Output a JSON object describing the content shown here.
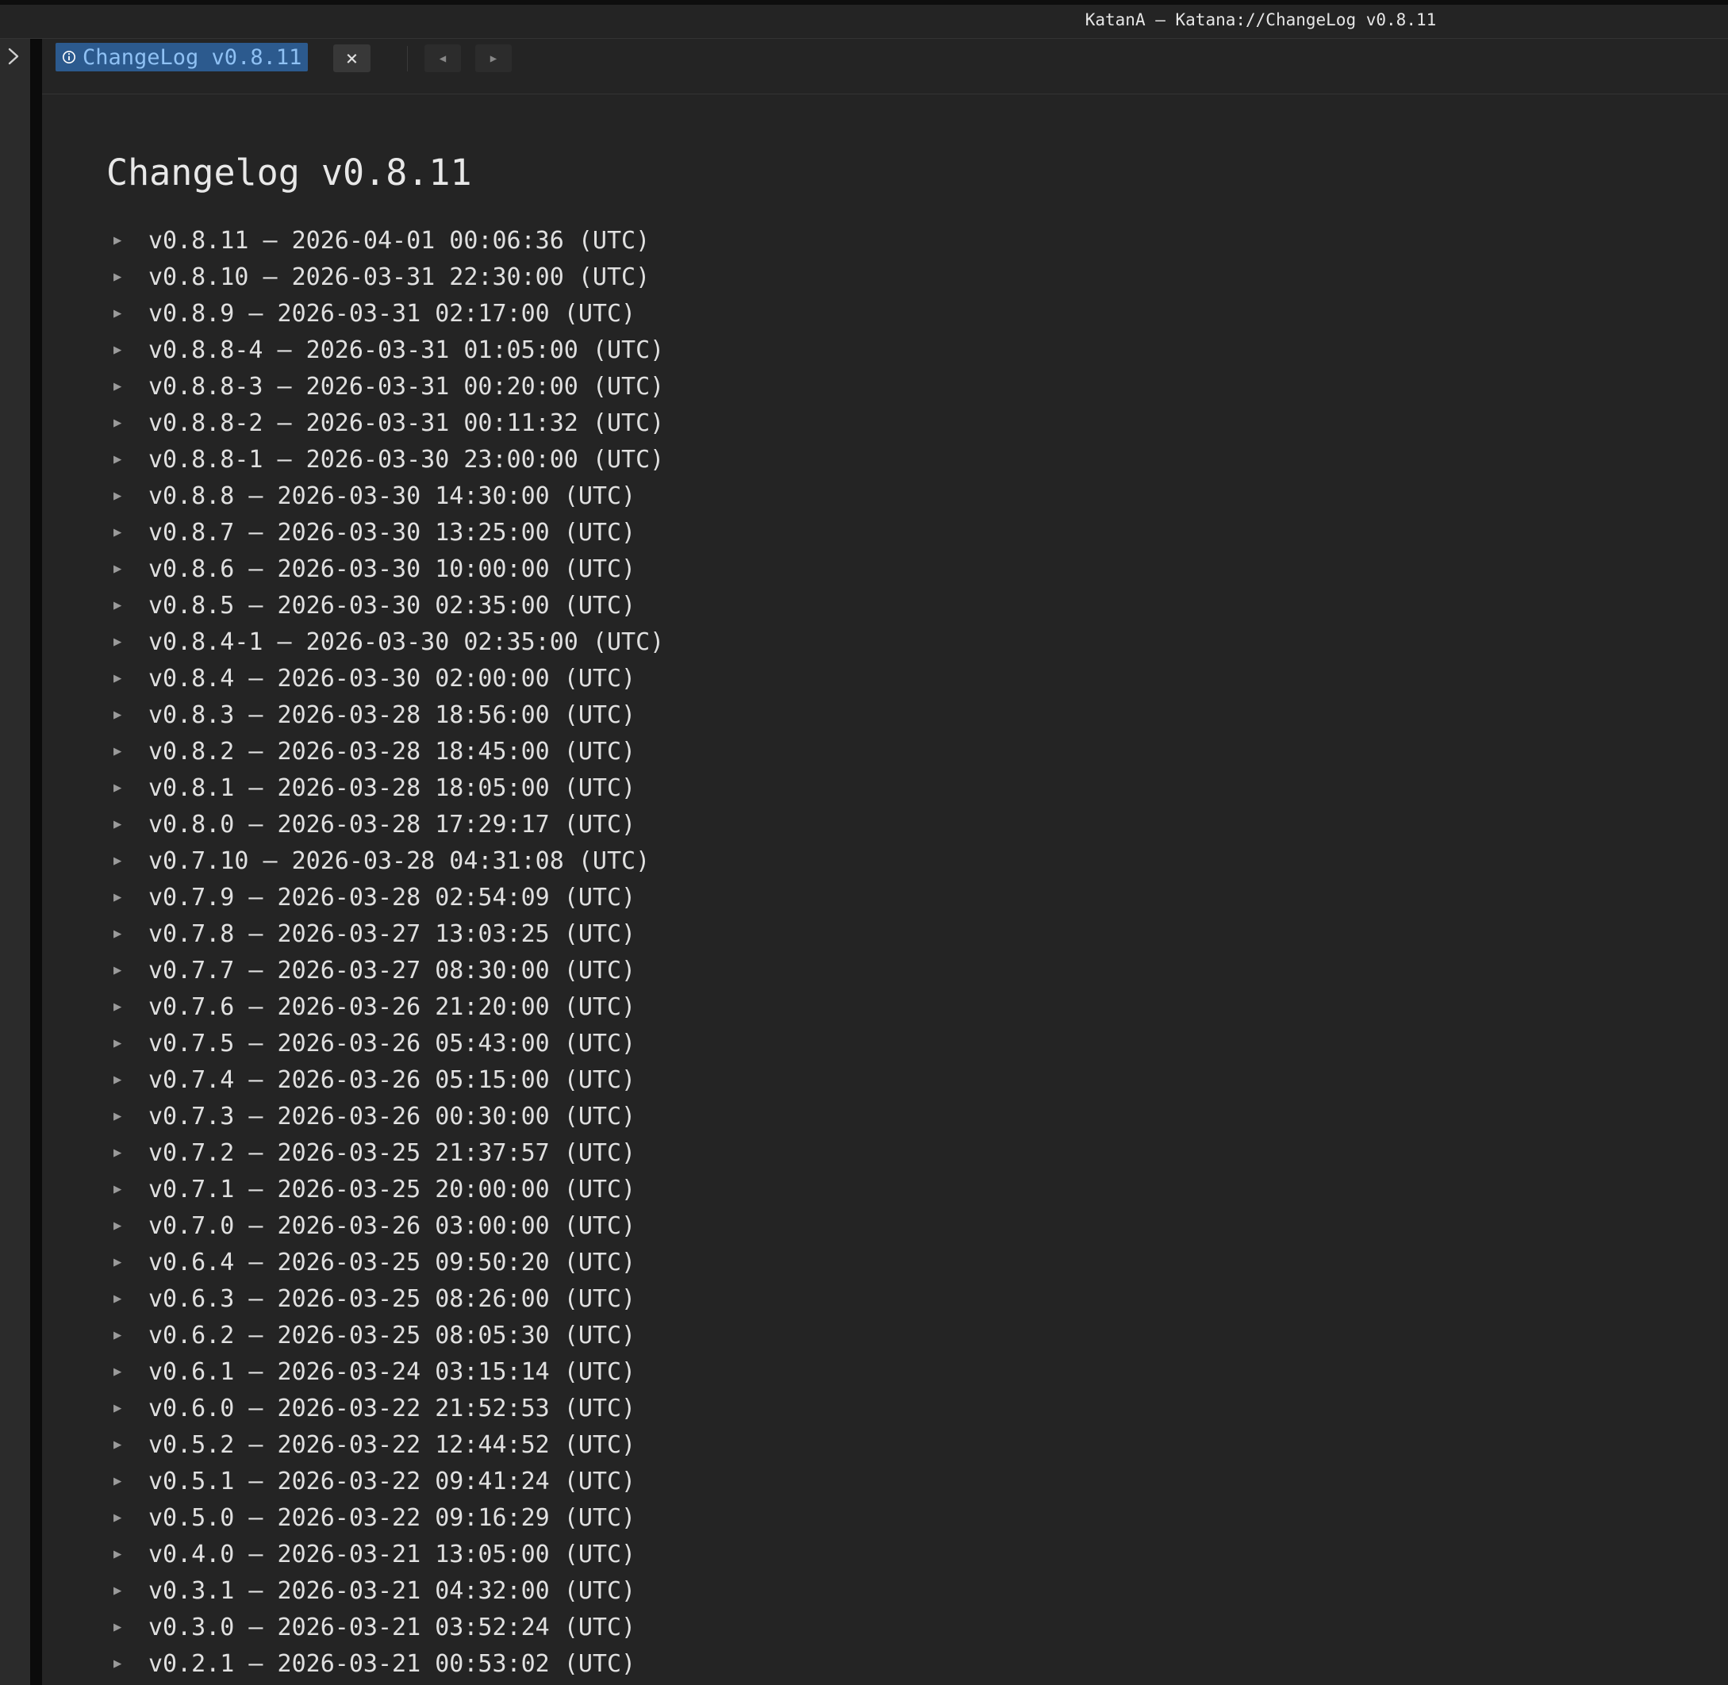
{
  "window": {
    "title": "KatanA — Katana://ChangeLog v0.8.11"
  },
  "sidebar": {
    "toggle_icon": "chevron-right-icon"
  },
  "tabs": [
    {
      "label": "ChangeLog v0.8.11",
      "icon": "info-icon",
      "active": true
    }
  ],
  "tabbar": {
    "close_label": "×",
    "back_label": "◀",
    "forward_label": "▶"
  },
  "page": {
    "title": "Changelog v0.8.11"
  },
  "entries": [
    {
      "label": "v0.8.11 — 2026-04-01 00:06:36 (UTC)"
    },
    {
      "label": "v0.8.10 — 2026-03-31 22:30:00 (UTC)"
    },
    {
      "label": "v0.8.9 — 2026-03-31 02:17:00 (UTC)"
    },
    {
      "label": "v0.8.8-4 — 2026-03-31 01:05:00 (UTC)"
    },
    {
      "label": "v0.8.8-3 — 2026-03-31 00:20:00 (UTC)"
    },
    {
      "label": "v0.8.8-2 — 2026-03-31 00:11:32 (UTC)"
    },
    {
      "label": "v0.8.8-1 — 2026-03-30 23:00:00 (UTC)"
    },
    {
      "label": "v0.8.8 — 2026-03-30 14:30:00 (UTC)"
    },
    {
      "label": "v0.8.7 — 2026-03-30 13:25:00 (UTC)"
    },
    {
      "label": "v0.8.6 — 2026-03-30 10:00:00 (UTC)"
    },
    {
      "label": "v0.8.5 — 2026-03-30 02:35:00 (UTC)"
    },
    {
      "label": "v0.8.4-1 — 2026-03-30 02:35:00 (UTC)"
    },
    {
      "label": "v0.8.4 — 2026-03-30 02:00:00 (UTC)"
    },
    {
      "label": "v0.8.3 — 2026-03-28 18:56:00 (UTC)"
    },
    {
      "label": "v0.8.2 — 2026-03-28 18:45:00 (UTC)"
    },
    {
      "label": "v0.8.1 — 2026-03-28 18:05:00 (UTC)"
    },
    {
      "label": "v0.8.0 — 2026-03-28 17:29:17 (UTC)"
    },
    {
      "label": "v0.7.10 — 2026-03-28 04:31:08 (UTC)"
    },
    {
      "label": "v0.7.9 — 2026-03-28 02:54:09 (UTC)"
    },
    {
      "label": "v0.7.8 — 2026-03-27 13:03:25 (UTC)"
    },
    {
      "label": "v0.7.7 — 2026-03-27 08:30:00 (UTC)"
    },
    {
      "label": "v0.7.6 — 2026-03-26 21:20:00 (UTC)"
    },
    {
      "label": "v0.7.5 — 2026-03-26 05:43:00 (UTC)"
    },
    {
      "label": "v0.7.4 — 2026-03-26 05:15:00 (UTC)"
    },
    {
      "label": "v0.7.3 — 2026-03-26 00:30:00 (UTC)"
    },
    {
      "label": "v0.7.2 — 2026-03-25 21:37:57 (UTC)"
    },
    {
      "label": "v0.7.1 — 2026-03-25 20:00:00 (UTC)"
    },
    {
      "label": "v0.7.0 — 2026-03-26 03:00:00 (UTC)"
    },
    {
      "label": "v0.6.4 — 2026-03-25 09:50:20 (UTC)"
    },
    {
      "label": "v0.6.3 — 2026-03-25 08:26:00 (UTC)"
    },
    {
      "label": "v0.6.2 — 2026-03-25 08:05:30 (UTC)"
    },
    {
      "label": "v0.6.1 — 2026-03-24 03:15:14 (UTC)"
    },
    {
      "label": "v0.6.0 — 2026-03-22 21:52:53 (UTC)"
    },
    {
      "label": "v0.5.2 — 2026-03-22 12:44:52 (UTC)"
    },
    {
      "label": "v0.5.1 — 2026-03-22 09:41:24 (UTC)"
    },
    {
      "label": "v0.5.0 — 2026-03-22 09:16:29 (UTC)"
    },
    {
      "label": "v0.4.0 — 2026-03-21 13:05:00 (UTC)"
    },
    {
      "label": "v0.3.1 — 2026-03-21 04:32:00 (UTC)"
    },
    {
      "label": "v0.3.0 — 2026-03-21 03:52:24 (UTC)"
    },
    {
      "label": "v0.2.1 — 2026-03-21 00:53:02 (UTC)"
    }
  ],
  "colors": {
    "background": "#242424",
    "tab_active": "#2c5a8e",
    "tab_text": "#8fc1f4",
    "text": "#e0e0e0"
  }
}
